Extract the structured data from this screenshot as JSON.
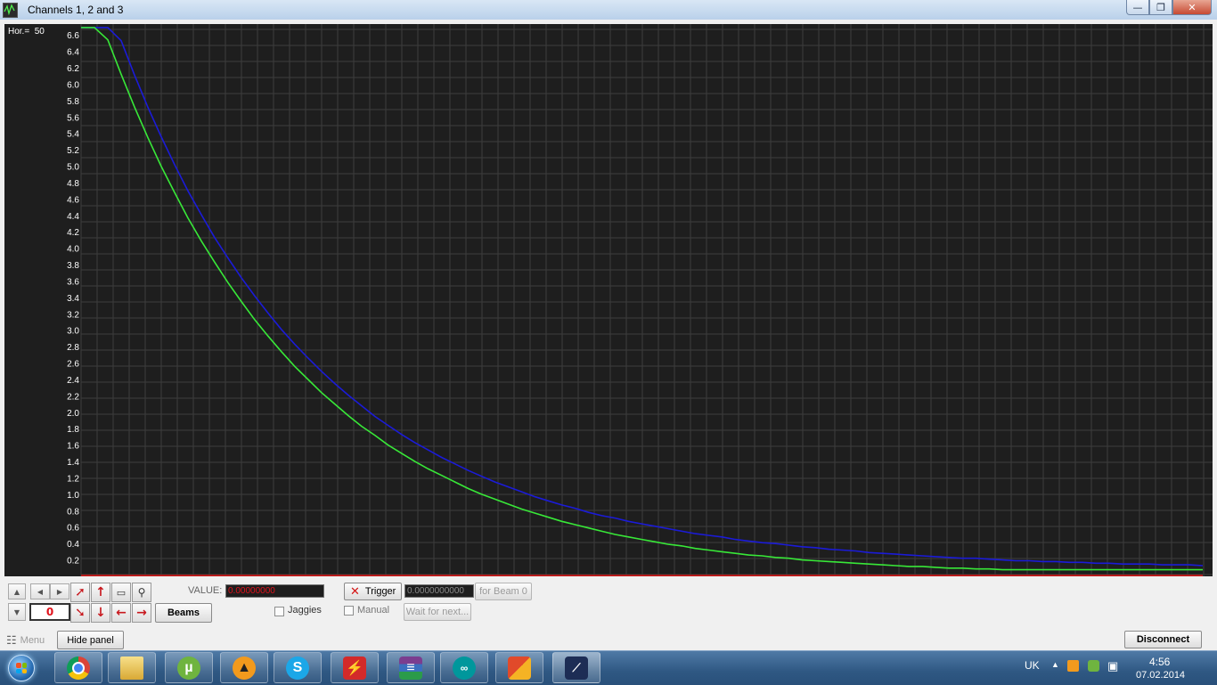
{
  "window": {
    "title": "Channels 1, 2 and 3",
    "controls": {
      "minimize": "—",
      "maximize": "❐",
      "close": "✕"
    }
  },
  "plot": {
    "hor_label": "Hor.=",
    "hor_value": "50"
  },
  "chart_data": {
    "type": "line",
    "title": "",
    "xlabel": "",
    "ylabel": "",
    "ylim": [
      0,
      6.7
    ],
    "y_ticks": [
      "6.6",
      "6.4",
      "6.2",
      "6.0",
      "5.8",
      "5.6",
      "5.4",
      "5.2",
      "5.0",
      "4.8",
      "4.6",
      "4.4",
      "4.2",
      "4.0",
      "3.8",
      "3.6",
      "3.4",
      "3.2",
      "3.0",
      "2.8",
      "2.6",
      "2.4",
      "2.2",
      "2.0",
      "1.8",
      "1.6",
      "1.4",
      "1.2",
      "1.0",
      "0.8",
      "0.6",
      "0.4",
      "0.2"
    ],
    "grid": true,
    "background": "#1e1e1e",
    "series": [
      {
        "color": "#1b1bd8",
        "x": [
          0,
          1,
          2,
          3,
          4,
          5,
          6,
          7,
          8,
          9,
          10,
          11,
          12,
          13,
          14,
          15,
          16,
          17,
          18,
          19,
          20,
          21,
          22,
          23,
          24,
          25,
          26,
          27,
          28,
          29,
          30,
          31,
          32,
          33,
          34,
          35,
          36,
          37,
          38,
          39,
          40,
          41,
          42,
          43,
          44,
          45,
          46,
          47,
          48,
          49,
          50,
          51,
          52,
          53,
          54,
          55,
          56,
          57,
          58,
          59,
          60,
          61,
          62,
          63,
          64,
          65,
          66,
          67,
          68,
          69,
          70,
          71,
          72,
          73,
          74,
          75,
          76,
          77,
          78,
          79,
          80,
          81,
          82,
          83,
          84
        ],
        "values": [
          6.69,
          6.69,
          6.69,
          6.53,
          6.11,
          5.72,
          5.36,
          5.02,
          4.7,
          4.41,
          4.13,
          3.88,
          3.64,
          3.42,
          3.21,
          3.01,
          2.83,
          2.66,
          2.5,
          2.35,
          2.21,
          2.08,
          1.95,
          1.84,
          1.73,
          1.63,
          1.54,
          1.45,
          1.37,
          1.29,
          1.22,
          1.15,
          1.09,
          1.03,
          0.97,
          0.92,
          0.87,
          0.83,
          0.78,
          0.74,
          0.71,
          0.67,
          0.64,
          0.61,
          0.58,
          0.55,
          0.52,
          0.5,
          0.48,
          0.45,
          0.43,
          0.41,
          0.4,
          0.38,
          0.36,
          0.35,
          0.33,
          0.32,
          0.31,
          0.29,
          0.28,
          0.27,
          0.26,
          0.25,
          0.24,
          0.23,
          0.22,
          0.22,
          0.21,
          0.2,
          0.19,
          0.19,
          0.18,
          0.18,
          0.17,
          0.17,
          0.16,
          0.16,
          0.15,
          0.15,
          0.15,
          0.14,
          0.14,
          0.14,
          0.13
        ]
      },
      {
        "color": "#38e838",
        "x": [
          0,
          1,
          2,
          3,
          4,
          5,
          6,
          7,
          8,
          9,
          10,
          11,
          12,
          13,
          14,
          15,
          16,
          17,
          18,
          19,
          20,
          21,
          22,
          23,
          24,
          25,
          26,
          27,
          28,
          29,
          30,
          31,
          32,
          33,
          34,
          35,
          36,
          37,
          38,
          39,
          40,
          41,
          42,
          43,
          44,
          45,
          46,
          47,
          48,
          49,
          50,
          51,
          52,
          53,
          54,
          55,
          56,
          57,
          58,
          59,
          60,
          61,
          62,
          63,
          64,
          65,
          66,
          67,
          68,
          69,
          70,
          71,
          72,
          73,
          74,
          75,
          76,
          77,
          78,
          79,
          80,
          81,
          82,
          83,
          84
        ],
        "values": [
          6.69,
          6.69,
          6.54,
          6.12,
          5.72,
          5.35,
          5.0,
          4.68,
          4.37,
          4.09,
          3.83,
          3.58,
          3.35,
          3.13,
          2.93,
          2.74,
          2.56,
          2.4,
          2.24,
          2.1,
          1.96,
          1.83,
          1.72,
          1.6,
          1.5,
          1.4,
          1.31,
          1.23,
          1.15,
          1.07,
          1.0,
          0.94,
          0.88,
          0.82,
          0.77,
          0.72,
          0.67,
          0.63,
          0.59,
          0.55,
          0.51,
          0.48,
          0.45,
          0.42,
          0.39,
          0.37,
          0.34,
          0.32,
          0.3,
          0.28,
          0.26,
          0.25,
          0.23,
          0.22,
          0.2,
          0.19,
          0.18,
          0.17,
          0.16,
          0.15,
          0.14,
          0.13,
          0.12,
          0.12,
          0.11,
          0.1,
          0.1,
          0.09,
          0.09,
          0.08,
          0.08,
          0.08,
          0.08,
          0.08,
          0.08,
          0.08,
          0.08,
          0.08,
          0.08,
          0.08,
          0.08,
          0.08,
          0.08,
          0.08,
          0.08
        ]
      },
      {
        "color": "#d41414",
        "x": [
          0,
          84
        ],
        "values": [
          0.01,
          0.01
        ]
      }
    ]
  },
  "controls": {
    "counter_value": "0",
    "value_label": "VALUE:",
    "value_display": "0.00000000",
    "trigger_label": "Trigger",
    "trigger_value": "0.0000000000",
    "for_beam_label": "for Beam 0",
    "beams_label": "Beams",
    "jaggies_label": "Jaggies",
    "manual_label": "Manual",
    "wait_label": "Wait for next..."
  },
  "bottom": {
    "menu_label": "Menu",
    "hide_panel_label": "Hide panel",
    "disconnect_label": "Disconnect"
  },
  "taskbar": {
    "apps": [
      "chrome-icon",
      "explorer-icon",
      "utorrent-icon",
      "aimp-icon",
      "skype-icon",
      "flash-icon",
      "winrar-icon",
      "arduino-icon",
      "office-icon",
      "oscilloscope-icon"
    ],
    "lang": "UK",
    "time": "4:56",
    "date": "07.02.2014"
  }
}
